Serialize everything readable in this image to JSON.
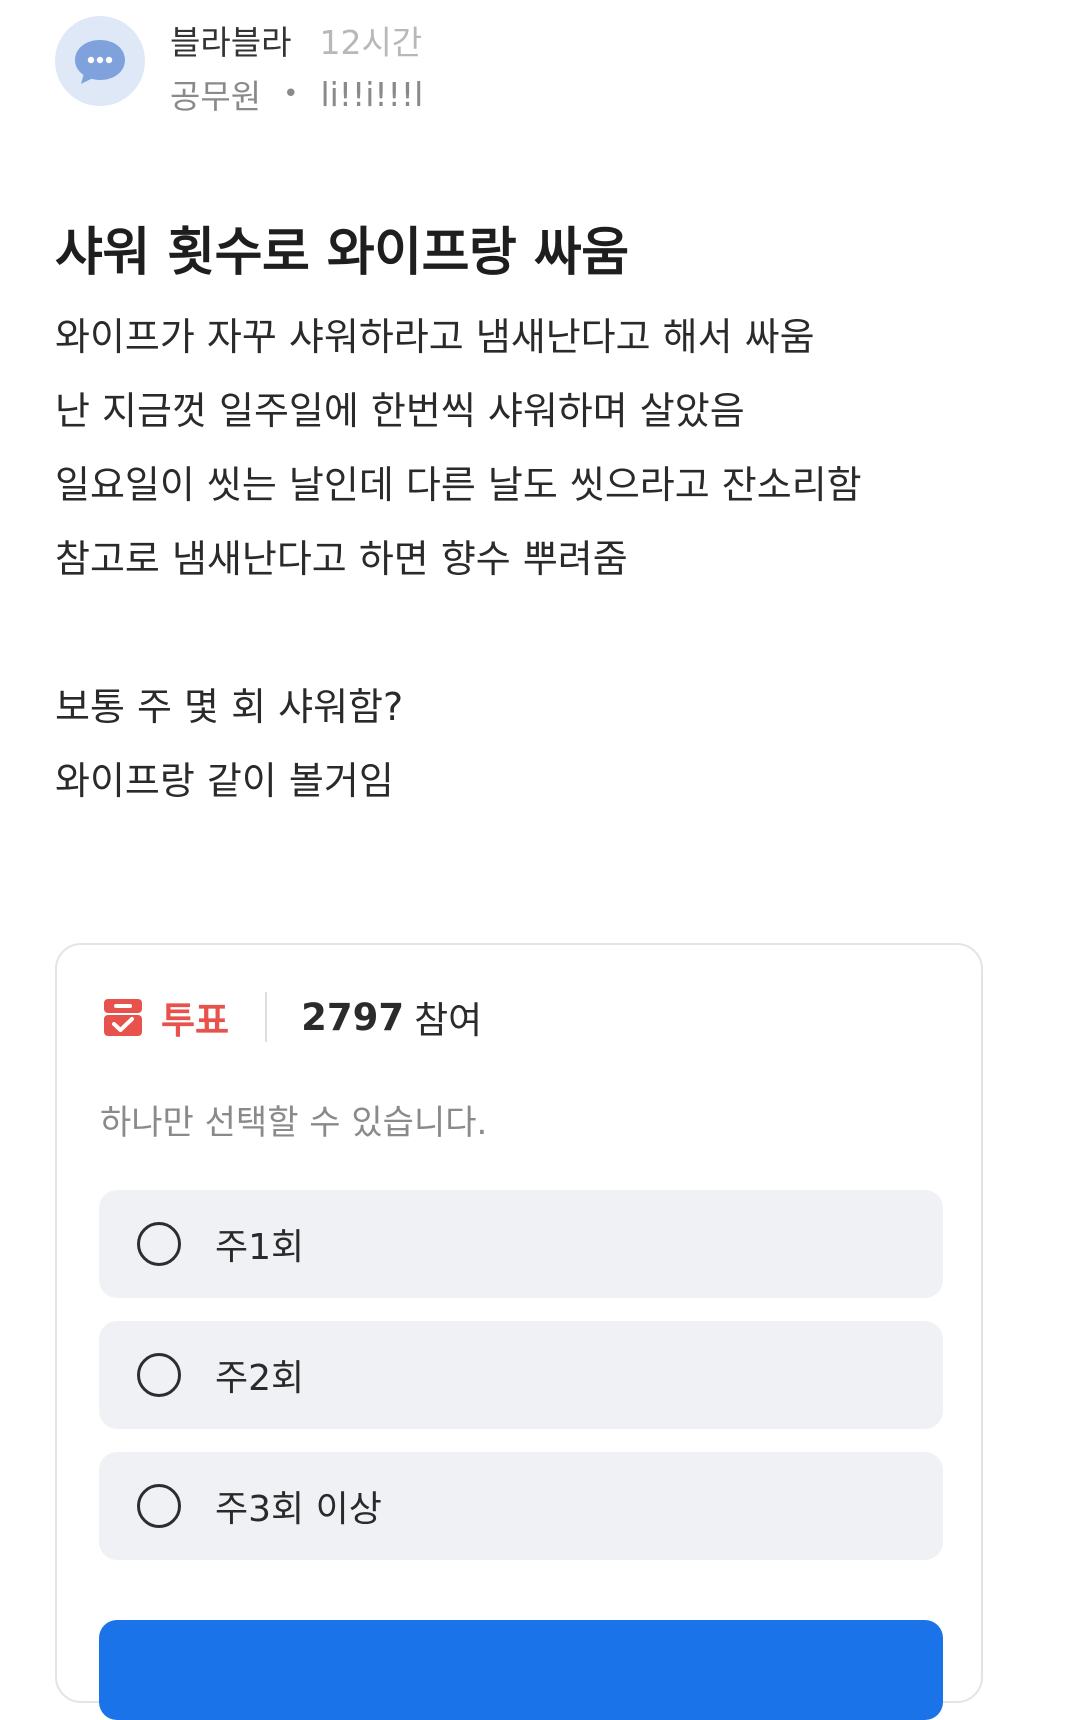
{
  "post": {
    "author": "블라블라",
    "time": "12시간",
    "company": "공무원",
    "separator": "•",
    "nickname": "li!!i!!!l",
    "title": "샤워 횟수로 와이프랑 싸움",
    "body_lines": [
      "와이프가 자꾸 샤워하라고 냄새난다고 해서 싸움",
      "난 지금껏 일주일에 한번씩 샤워하며 살았음",
      "일요일이 씻는 날인데 다른 날도 씻으라고 잔소리함",
      "참고로 냄새난다고 하면 향수 뿌려줌",
      "",
      "보통 주 몇 회 샤워함?",
      "와이프랑 같이 볼거임"
    ]
  },
  "poll": {
    "label": "투표",
    "count": "2797",
    "count_unit": "참여",
    "instruction": "하나만 선택할 수 있습니다.",
    "options": [
      {
        "label": "주1회"
      },
      {
        "label": "주2회"
      },
      {
        "label": "주3회 이상"
      }
    ]
  },
  "icons": {
    "avatar": "chat-bubble-icon",
    "poll": "ballot-box-icon",
    "option_marker": "radio-empty-icon"
  },
  "colors": {
    "poll_accent": "#e8524d",
    "avatar_bg": "#dfe8f7",
    "avatar_icon": "#7fa2dc",
    "button": "#1a73e8",
    "option_bg": "#eff1f4"
  }
}
